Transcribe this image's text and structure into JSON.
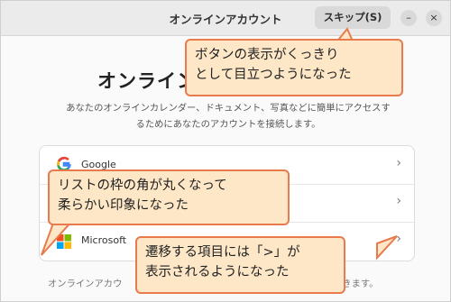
{
  "window": {
    "title": "オンラインアカウント",
    "skip_label": "スキップ(S)",
    "minimize_symbol": "–",
    "close_symbol": "×"
  },
  "main": {
    "heading": "オンライン",
    "description_lines": [
      "あなたのオンラインカレンダー、ドキュメント、写真などに簡単にアクセスす",
      "るためにあなたのアカウントを接続します。"
    ],
    "accounts": [
      {
        "label": "Google",
        "chevron": "›",
        "icon": "google-icon"
      },
      {
        "label": "",
        "chevron": "›",
        "icon": "nextcloud-icon"
      },
      {
        "label": "Microsoft",
        "chevron": "›",
        "icon": "microsoft-icon"
      }
    ],
    "footer_left": "オンラインアカウ",
    "footer_right": "できます。"
  },
  "callouts": {
    "button": [
      "ボタンの表示がくっきり",
      "として目立つようになった"
    ],
    "list": [
      "リストの枠の角が丸くなって",
      "柔らかい印象になった"
    ],
    "chevron": [
      "遷移する項目には「>」が",
      "表示されるようになった"
    ]
  },
  "colors": {
    "callout_fill": "#fde7c7",
    "callout_border": "#e87a4d",
    "headerbar": "#ebebeb"
  }
}
